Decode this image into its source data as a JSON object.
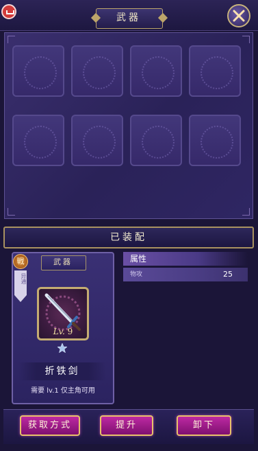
{
  "window": {
    "title": "武器"
  },
  "equipped": {
    "header": "已装配",
    "card": {
      "tab_label": "武器",
      "seal_char": "戦",
      "ribbon_text": "异通",
      "item": {
        "level_prefix": "Lv.",
        "level_value": "9",
        "star_count": 1,
        "name": "折铁剑",
        "requirement": "需要 lv.1 仅主角可用"
      }
    },
    "attributes": {
      "header": "属性",
      "rows": [
        {
          "name": "物攻",
          "value": "25"
        }
      ]
    }
  },
  "inventory": {
    "slots": 8,
    "filled": 0
  },
  "actions": {
    "obtain_label": "获取方式",
    "upgrade_label": "提升",
    "unequip_label": "卸下"
  },
  "colors": {
    "accent_gold": "#c5ad72",
    "button_magenta": "#bd2aa2",
    "panel_purple": "#2f2663"
  }
}
